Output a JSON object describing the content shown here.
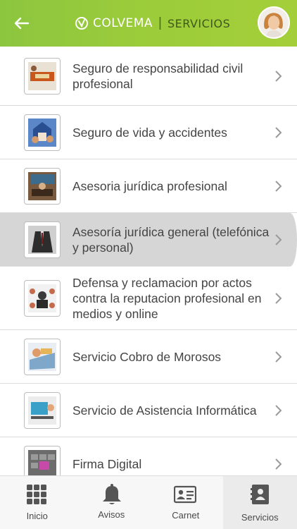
{
  "header": {
    "brand": "COLVEMA",
    "separator": "|",
    "section": "SERVICIOS",
    "bg_color": "#94c93c"
  },
  "services": [
    {
      "label": "Seguro de responsabilidad civil profesional",
      "icon": "liability-insurance-photo"
    },
    {
      "label": "Seguro de vida y accidentes",
      "icon": "life-insurance-photo"
    },
    {
      "label": "Asesoria jurídica profesional",
      "icon": "legal-advice-photo"
    },
    {
      "label": "Asesoría jurídica general (telefónica y personal)",
      "icon": "general-legal-advice-photo",
      "selected": true
    },
    {
      "label": "Defensa y reclamacion por actos contra la reputacion profesional en medios y online",
      "icon": "reputation-defense-photo"
    },
    {
      "label": "Servicio Cobro de Morosos",
      "icon": "debt-collection-photo"
    },
    {
      "label": "Servicio de Asistencia Informática",
      "icon": "it-support-photo"
    },
    {
      "label": "Firma Digital",
      "icon": "digital-signature-photo"
    }
  ],
  "tabs": [
    {
      "label": "Inicio",
      "icon": "grid-icon"
    },
    {
      "label": "Avisos",
      "icon": "bell-icon"
    },
    {
      "label": "Carnet",
      "icon": "id-card-icon"
    },
    {
      "label": "Servicios",
      "icon": "contacts-book-icon",
      "active": true
    }
  ]
}
